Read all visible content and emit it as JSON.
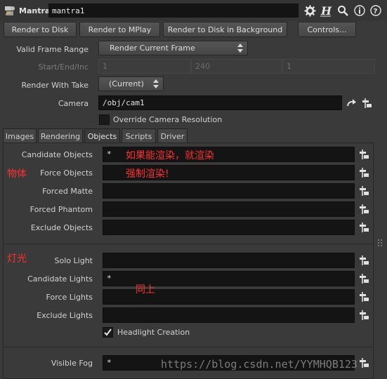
{
  "header": {
    "node_type": "Mantra",
    "node_name": "mantra1",
    "icons": [
      "gear-icon",
      "help-h-icon",
      "search-icon",
      "info-icon",
      "question-icon"
    ]
  },
  "buttons": {
    "render_to_disk": "Render to Disk",
    "render_to_mplay": "Render to MPlay",
    "render_bg": "Render to Disk in Background",
    "controls": "Controls..."
  },
  "params": {
    "valid_frame_range_label": "Valid Frame Range",
    "valid_frame_range_value": "Render Current Frame",
    "start_end_inc_label": "Start/End/Inc",
    "start": "1",
    "end": "240",
    "inc": "1",
    "render_with_take_label": "Render With Take",
    "render_with_take_value": "(Current)",
    "camera_label": "Camera",
    "camera_value": "/obj/cam1",
    "override_camera_label": "Override Camera Resolution"
  },
  "tabs": [
    "Images",
    "Rendering",
    "Objects",
    "Scripts",
    "Driver"
  ],
  "active_tab": "Objects",
  "objects": {
    "candidate_objects_label": "Candidate Objects",
    "candidate_objects_value": "*",
    "force_objects_label": "Force Objects",
    "force_objects_value": "",
    "forced_matte_label": "Forced Matte",
    "forced_phantom_label": "Forced Phantom",
    "exclude_objects_label": "Exclude Objects",
    "solo_light_label": "Solo Light",
    "candidate_lights_label": "Candidate Lights",
    "candidate_lights_value": "*",
    "force_lights_label": "Force Lights",
    "exclude_lights_label": "Exclude Lights",
    "headlight_label": "Headlight Creation",
    "visible_fog_label": "Visible Fog",
    "visible_fog_value": "*"
  },
  "annotations": {
    "objects_heading": "物体",
    "lights_heading": "灯光",
    "candidate_note": "如果能渲染，就渲染",
    "force_note": "强制渲染!",
    "lights_note": "同上",
    "color": "#ff3030"
  },
  "watermark": "https://blog.csdn.net/YYMHQB123"
}
